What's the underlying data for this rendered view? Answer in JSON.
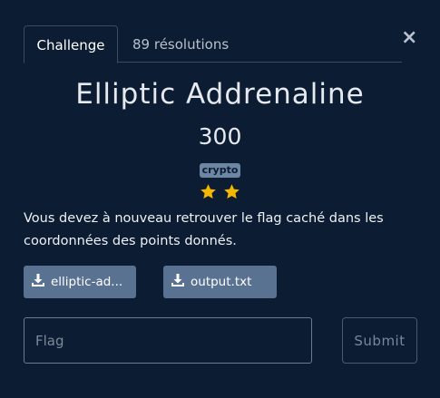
{
  "modal": {
    "close_symbol": "×"
  },
  "tabs": [
    {
      "label": "Challenge",
      "active": true
    },
    {
      "label": "89 résolutions",
      "active": false
    }
  ],
  "challenge": {
    "title": "Elliptic Addrenaline",
    "points": "300",
    "tag": "crypto",
    "difficulty_stars": 2,
    "description": "Vous devez à nouveau retrouver le flag caché dans les coordonnées des points donnés."
  },
  "files": [
    {
      "label": "elliptic-ad...",
      "icon": "download-icon"
    },
    {
      "label": "output.txt",
      "icon": "download-icon"
    }
  ],
  "flag_form": {
    "placeholder": "Flag",
    "value": "",
    "submit_label": "Submit"
  },
  "colors": {
    "background": "#0c1c33",
    "tag_bg": "#6c86a3",
    "file_button_bg": "#5a7291",
    "star": "#f5b800"
  }
}
